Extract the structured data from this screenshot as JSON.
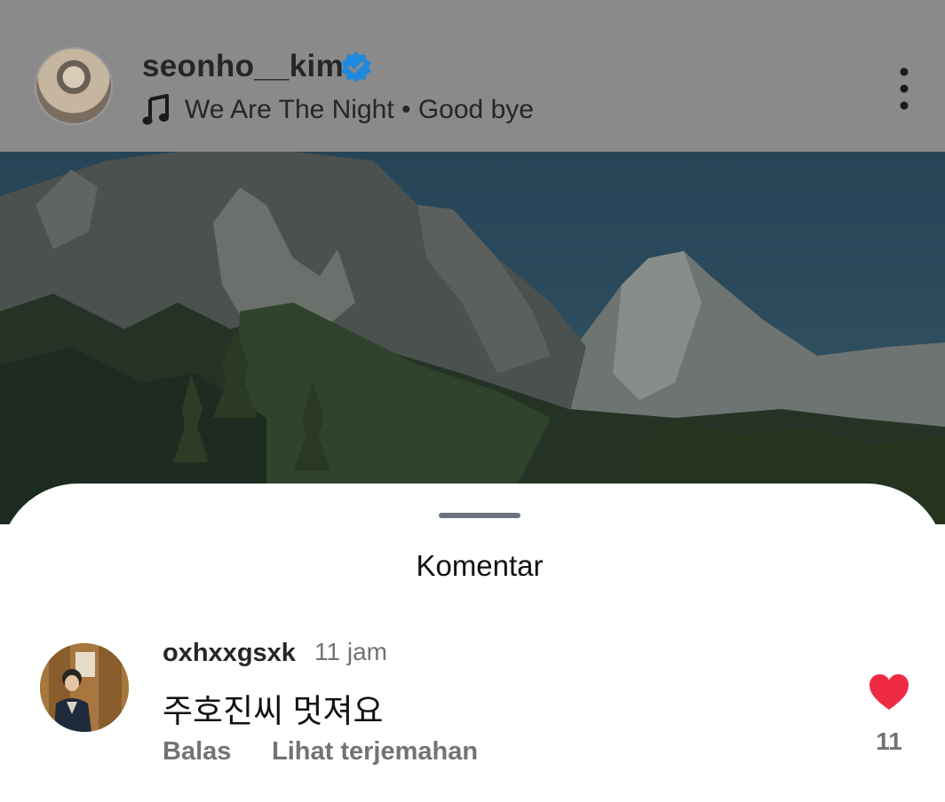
{
  "post": {
    "username": "seonho__kim",
    "verified": true,
    "music": "We Are The Night • Good bye",
    "icons": [
      "verified-badge-icon",
      "music-note-icon",
      "more-vertical-icon"
    ]
  },
  "comments_sheet": {
    "title": "Komentar",
    "comments": [
      {
        "username": "oxhxxgsxk",
        "time": "11 jam",
        "text": "주호진씨 멋져요",
        "reply_label": "Balas",
        "translate_label": "Lihat terjemahan",
        "likes": "11",
        "liked": true
      }
    ]
  },
  "colors": {
    "verified_blue": "#1d8ae0",
    "heart_red": "#ef2b44",
    "secondary_text": "#737373"
  }
}
